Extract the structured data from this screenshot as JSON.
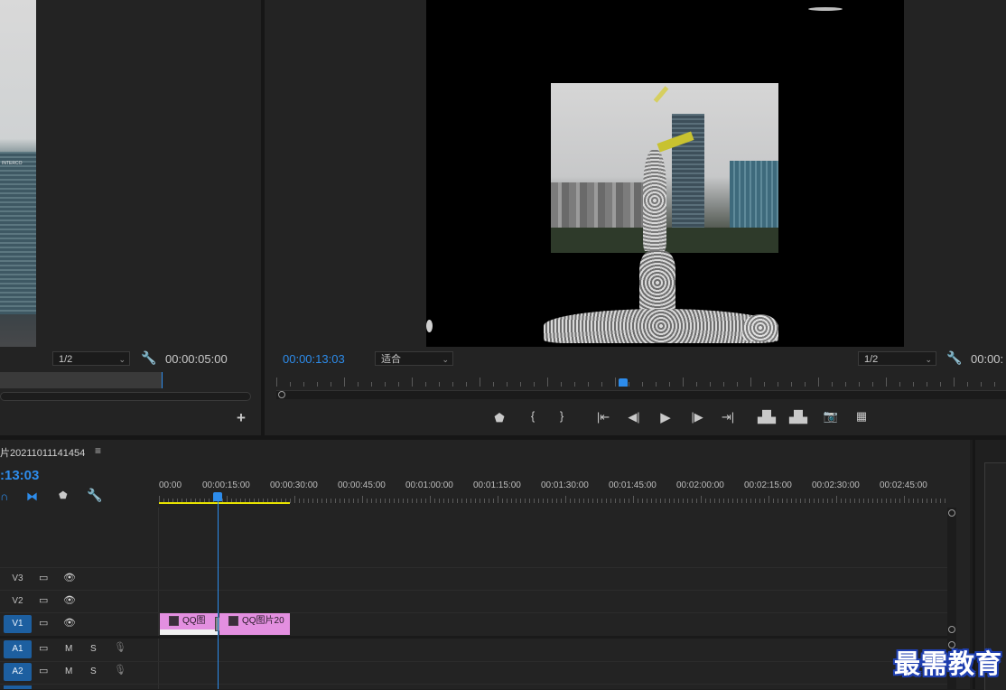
{
  "source_monitor": {
    "zoom": "1/2",
    "duration": "00:00:05:00",
    "add_label": "+"
  },
  "program_monitor": {
    "timecode": "00:00:13:03",
    "fit": "适合",
    "resolution": "1/2",
    "duration": "00:00:"
  },
  "transport": {
    "marker": "marker-icon",
    "in": "mark-in-icon",
    "out": "mark-out-icon",
    "go_in": "go-to-in-icon",
    "step_back": "step-back-icon",
    "play": "play-icon",
    "step_fwd": "step-forward-icon",
    "go_out": "go-to-out-icon",
    "lift": "lift-icon",
    "extract": "extract-icon",
    "export_frame": "camera-icon",
    "compare": "compare-icon"
  },
  "timeline": {
    "sequence_name": "片20211011141454",
    "menu_label": "≡",
    "timecode": ":13:03",
    "ruler": [
      "00:00",
      "00:00:15:00",
      "00:00:30:00",
      "00:00:45:00",
      "00:01:00:00",
      "00:01:15:00",
      "00:01:30:00",
      "00:01:45:00",
      "00:02:00:00",
      "00:02:15:00",
      "00:02:30:00",
      "00:02:45:00"
    ],
    "tracks": [
      {
        "name": "V3",
        "type": "video"
      },
      {
        "name": "V2",
        "type": "video"
      },
      {
        "name": "V1",
        "type": "video",
        "selected": true
      },
      {
        "name": "A1",
        "type": "audio",
        "selected": true,
        "m": "M",
        "s": "S"
      },
      {
        "name": "A2",
        "type": "audio",
        "selected": true,
        "m": "M",
        "s": "S"
      }
    ],
    "clips": [
      {
        "label": "QQ图"
      },
      {
        "label": "QQ图片20"
      }
    ]
  },
  "watermark": "最需教育",
  "colors": {
    "accent": "#2d8ceb",
    "clip": "#e38fe0",
    "work_area": "#e8e300",
    "track_selected": "#1d5fa0"
  }
}
